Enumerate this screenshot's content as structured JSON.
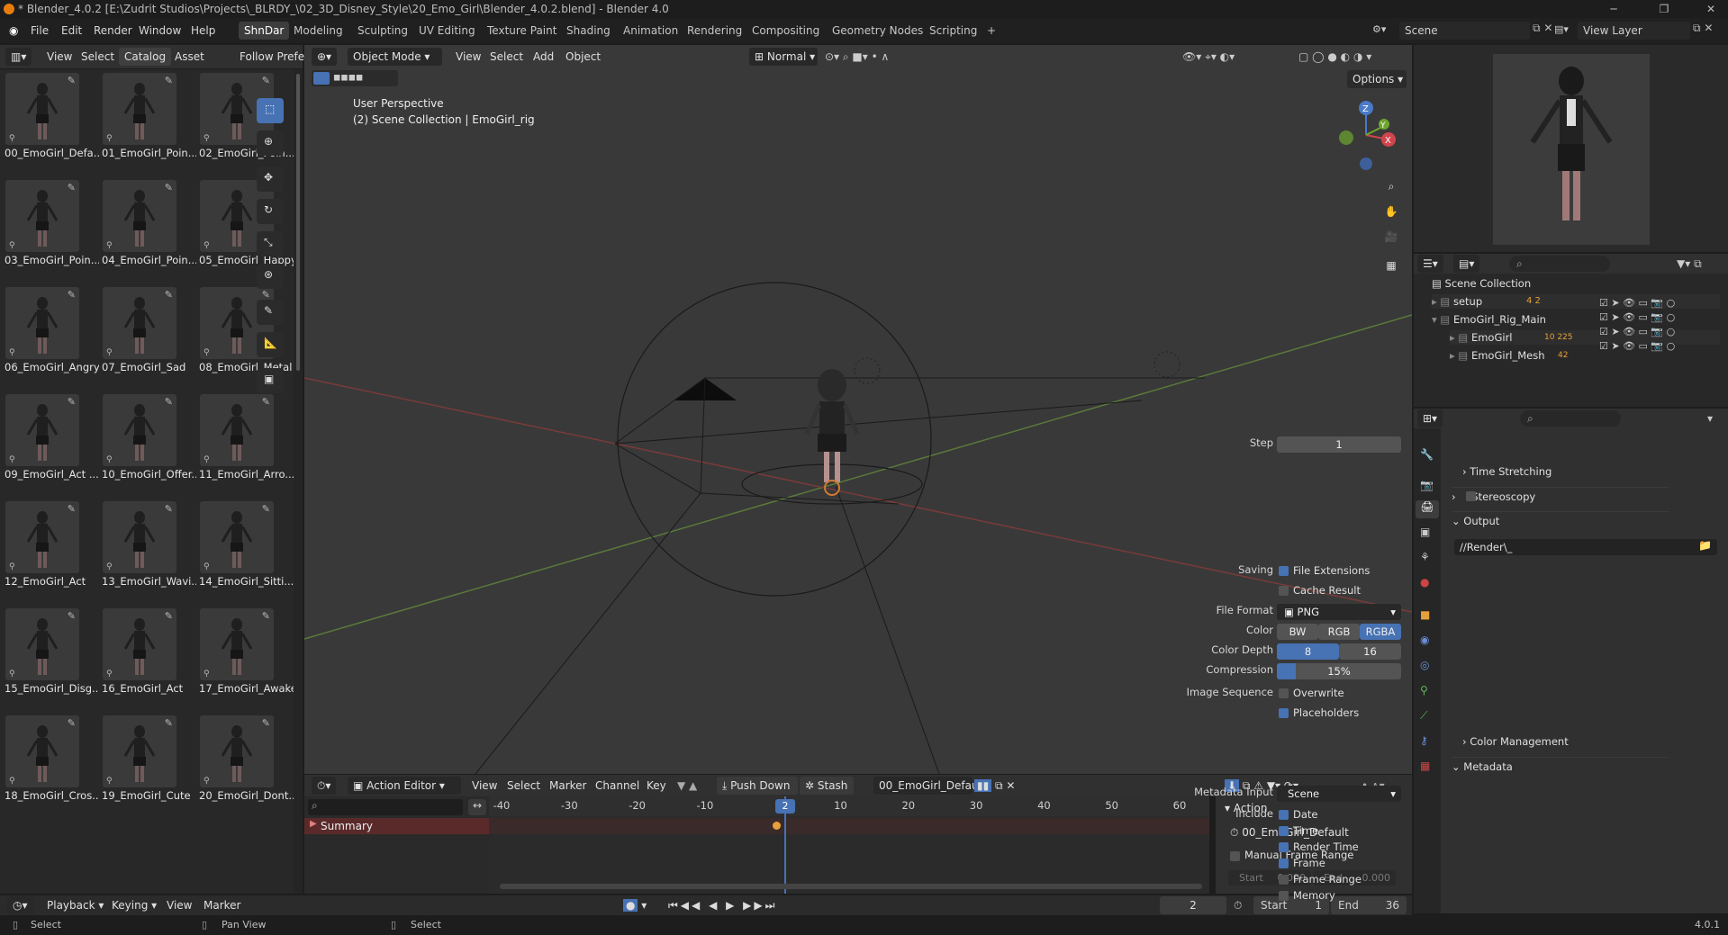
{
  "window": {
    "title": "* Blender_4.0.2 [E:\\Zudrit Studios\\Projects\\_BLRDY_\\02_3D_Disney_Style\\20_Emo_Girl\\Blender_4.0.2.blend] - Blender 4.0"
  },
  "menu": [
    "File",
    "Edit",
    "Render",
    "Window",
    "Help"
  ],
  "workspaces": [
    "ShnDar",
    "Modeling",
    "Sculpting",
    "UV Editing",
    "Texture Paint",
    "Shading",
    "Animation",
    "Rendering",
    "Compositing",
    "Geometry Nodes",
    "Scripting"
  ],
  "active_workspace": "ShnDar",
  "scene": {
    "name": "Scene",
    "view_layer": "View Layer"
  },
  "asset_browser": {
    "menu": [
      "View",
      "Select",
      "Catalog",
      "Asset"
    ],
    "follow": "Follow Prefer",
    "items": [
      "00_EmoGirl_Defa...",
      "01_EmoGirl_Poin...",
      "02_EmoGirl_Poin...",
      "03_EmoGirl_Poin...",
      "04_EmoGirl_Poin...",
      "05_EmoGirl_Happy",
      "06_EmoGirl_Angry",
      "07_EmoGirl_Sad",
      "08_EmoGirl_Metal",
      "09_EmoGirl_Act ...",
      "10_EmoGirl_Offer...",
      "11_EmoGirl_Arro...",
      "12_EmoGirl_Act",
      "13_EmoGirl_Wavi...",
      "14_EmoGirl_Sitti...",
      "15_EmoGirl_Disg...",
      "16_EmoGirl_Act",
      "17_EmoGirl_Awake",
      "18_EmoGirl_Cros...",
      "19_EmoGirl_Cute",
      "20_EmoGirl_Dont..."
    ]
  },
  "viewport": {
    "mode": "Object Mode",
    "menu": [
      "View",
      "Select",
      "Add",
      "Object"
    ],
    "orientation": "Normal",
    "options": "Options",
    "overlay_line1": "User Perspective",
    "overlay_line2": "(2) Scene Collection | EmoGirl_rig",
    "axes": {
      "x": "X",
      "y": "Y",
      "z": "Z"
    }
  },
  "outliner": {
    "root": "Scene Collection",
    "rows": [
      {
        "name": "setup",
        "extra": "4  2"
      },
      {
        "name": "EmoGirl_Rig_Main",
        "extra": ""
      },
      {
        "name": "EmoGirl",
        "extra": "10 225"
      },
      {
        "name": "EmoGirl_Mesh",
        "extra": "42"
      }
    ]
  },
  "properties": {
    "step_label": "Step",
    "step_value": "1",
    "time_stretching": "Time Stretching",
    "stereoscopy": "Stereoscopy",
    "output": "Output",
    "path": "//Render\\_",
    "saving": "Saving",
    "file_extensions": "File Extensions",
    "cache_result": "Cache Result",
    "file_format_label": "File Format",
    "file_format": "PNG",
    "color_label": "Color",
    "color_opts": [
      "BW",
      "RGB",
      "RGBA"
    ],
    "color_depth_label": "Color Depth",
    "depth_opts": [
      "8",
      "16"
    ],
    "compression_label": "Compression",
    "compression": "15%",
    "compression_fraction": 0.15,
    "image_seq": "Image Sequence",
    "overwrite": "Overwrite",
    "placeholders": "Placeholders",
    "color_mgmt": "Color Management",
    "metadata": "Metadata",
    "metadata_input_label": "Metadata Input",
    "metadata_input": "Scene",
    "include": "Include",
    "include_items": [
      "Date",
      "Time",
      "Render Time",
      "Frame",
      "Frame Range",
      "Memory"
    ],
    "include_checked": [
      true,
      true,
      true,
      true,
      false,
      false
    ]
  },
  "action_editor": {
    "mode": "Action Editor",
    "menu": [
      "View",
      "Select",
      "Marker",
      "Channel",
      "Key"
    ],
    "push_down": "Push Down",
    "stash": "Stash",
    "action": "00_EmoGirl_Default",
    "summary": "Summary",
    "ticks": [
      "-40",
      "-30",
      "-20",
      "-10",
      "0",
      "10",
      "20",
      "30",
      "40",
      "50",
      "60"
    ],
    "current": "2",
    "panel_title": "Action",
    "panel_action": "00_EmoGirl_Default",
    "manual_frame_range": "Manual Frame Range",
    "start_label": "Start",
    "start_val": "0.000",
    "end_label": "End",
    "end_val": "0.000"
  },
  "timeline": {
    "menu": [
      "Playback",
      "Keying",
      "View",
      "Marker"
    ],
    "frame": "2",
    "start_label": "Start",
    "start": "1",
    "end_label": "End",
    "end": "36"
  },
  "status": {
    "left": "Select",
    "mid": "Pan View",
    "right": "Select",
    "version": "4.0.1"
  },
  "colors": {
    "accent": "#4772b3",
    "bg": "#303030",
    "header": "#1d1d1d"
  }
}
